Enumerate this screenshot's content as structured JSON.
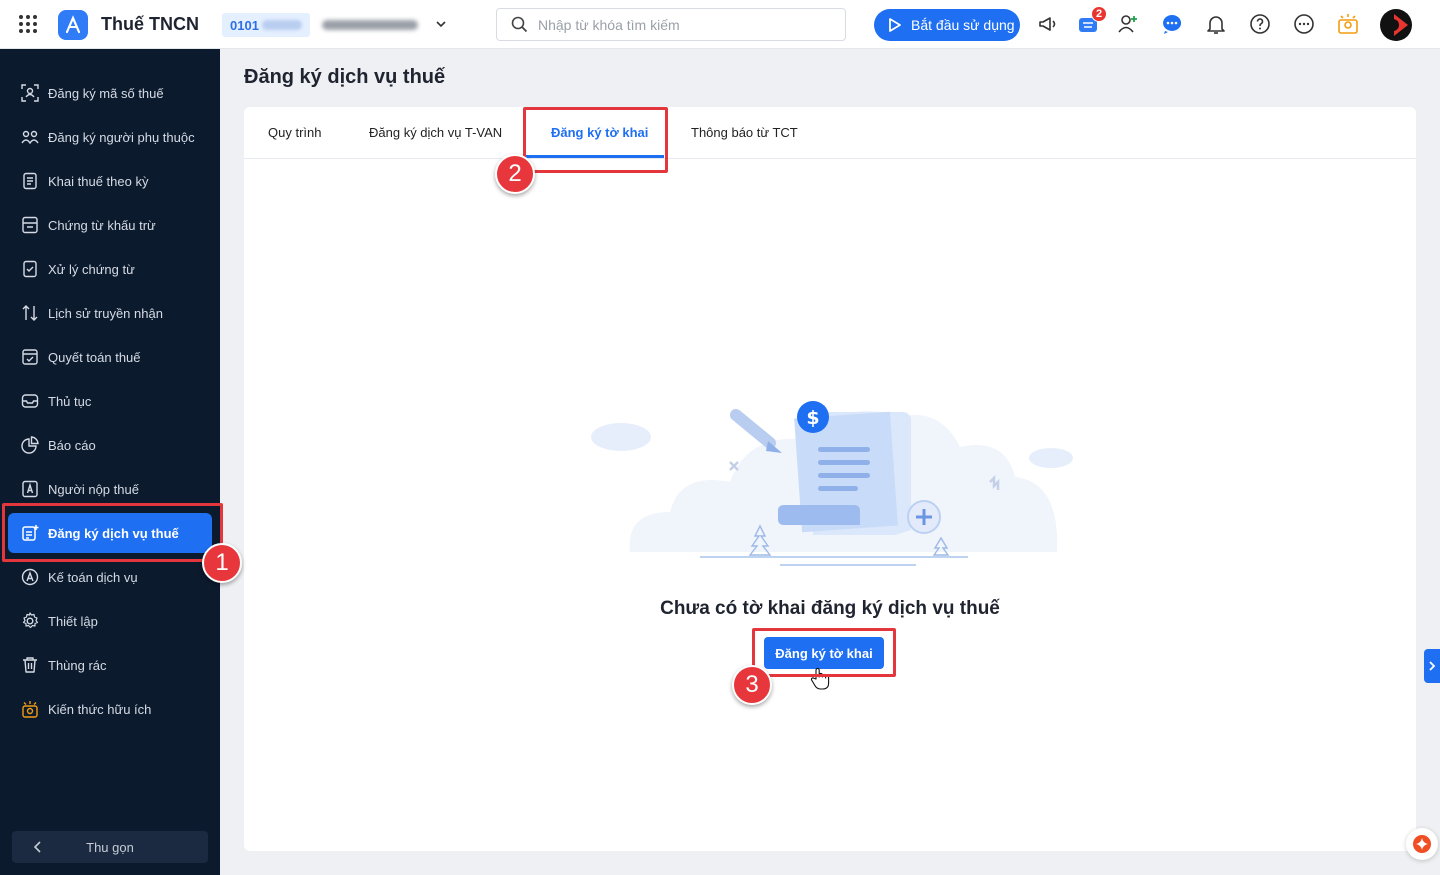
{
  "app": {
    "title": "Thuế TNCN"
  },
  "org": {
    "tax_code_prefix": "0101"
  },
  "search": {
    "placeholder": "Nhập từ khóa tìm kiếm"
  },
  "header": {
    "start_button": "Bắt đầu sử dụng",
    "cart_badge": "2"
  },
  "sidebar": {
    "items": [
      {
        "label": "Đăng ký mã số thuế",
        "icon": "tax-id-scan-icon"
      },
      {
        "label": "Đăng ký người phụ thuộc",
        "icon": "dependents-icon"
      },
      {
        "label": "Khai thuế theo kỳ",
        "icon": "periodic-declaration-icon"
      },
      {
        "label": "Chứng từ khấu trừ",
        "icon": "withholding-voucher-icon"
      },
      {
        "label": "Xử lý chứng từ",
        "icon": "document-check-icon"
      },
      {
        "label": "Lịch sử truyền nhận",
        "icon": "transfer-arrows-icon"
      },
      {
        "label": "Quyết toán thuế",
        "icon": "tax-settlement-icon"
      },
      {
        "label": "Thủ tục",
        "icon": "procedure-icon"
      },
      {
        "label": "Báo cáo",
        "icon": "report-pie-icon"
      },
      {
        "label": "Người nộp thuế",
        "icon": "taxpayer-icon"
      },
      {
        "label": "Đăng ký dịch vụ thuế",
        "icon": "service-register-icon",
        "active": true
      },
      {
        "label": "Kế toán dịch vụ",
        "icon": "accounting-service-icon"
      },
      {
        "label": "Thiết lập",
        "icon": "settings-gear-icon"
      },
      {
        "label": "Thùng rác",
        "icon": "trash-icon"
      },
      {
        "label": "Kiến thức hữu ích",
        "icon": "knowledge-bulb-icon"
      }
    ],
    "collapse_label": "Thu gọn"
  },
  "main": {
    "page_title": "Đăng ký dịch vụ thuế",
    "tabs": [
      {
        "label": "Quy trình"
      },
      {
        "label": "Đăng ký dịch vụ T-VAN"
      },
      {
        "label": "Đăng ký tờ khai",
        "active": true
      },
      {
        "label": "Thông báo từ TCT"
      }
    ],
    "empty_state": {
      "message": "Chưa có tờ khai đăng ký dịch vụ thuế",
      "button_label": "Đăng ký tờ khai"
    }
  },
  "steps": [
    "1",
    "2",
    "3"
  ],
  "colors": {
    "accent": "#1e6ff2",
    "sidebar_bg": "#0c1a2e",
    "highlight": "#e4373d",
    "badge": "#e8352f"
  }
}
